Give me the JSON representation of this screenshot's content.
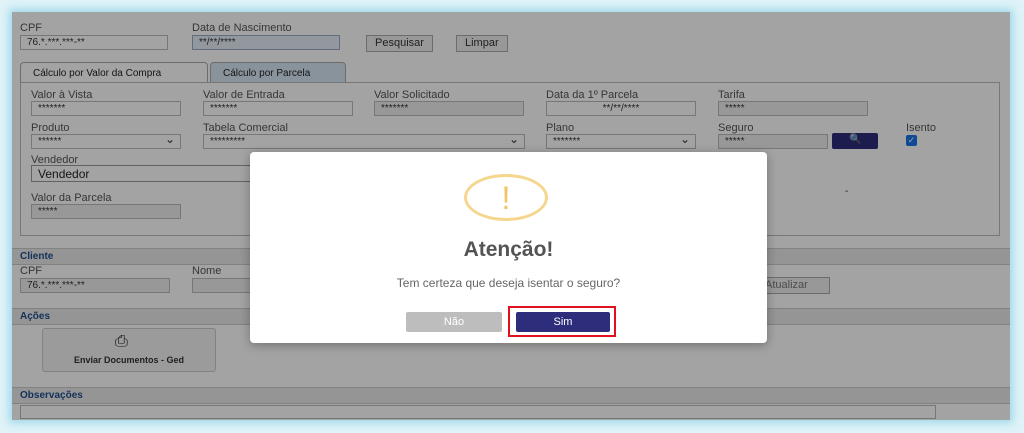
{
  "top": {
    "cpf_label": "CPF",
    "cpf_value": "76.*.***.***-**",
    "birth_label": "Data de Nascimento",
    "birth_value": "**/**/****",
    "search_button": "Pesquisar",
    "clear_button": "Limpar"
  },
  "tabs": [
    {
      "label": "Cálculo por Valor da Compra"
    },
    {
      "label": "Cálculo por Parcela"
    }
  ],
  "form": {
    "valor_vista": {
      "label": "Valor à Vista",
      "value": "*******"
    },
    "valor_entrada": {
      "label": "Valor de Entrada",
      "value": "*******"
    },
    "valor_solicitado": {
      "label": "Valor Solicitado",
      "value": "*******"
    },
    "data_parcela": {
      "label": "Data da 1º Parcela",
      "value": "**/**/****"
    },
    "tarifa": {
      "label": "Tarifa",
      "value": "*****"
    },
    "produto": {
      "label": "Produto",
      "value": "******"
    },
    "tabela": {
      "label": "Tabela Comercial",
      "value": "*********"
    },
    "plano": {
      "label": "Plano",
      "value": "*******"
    },
    "seguro": {
      "label": "Seguro",
      "value": "*****"
    },
    "isento": {
      "label": "Isento",
      "checked": true
    },
    "vendedor": {
      "label": "Vendedor",
      "value": "Vendedor"
    },
    "valor_parcela": {
      "label": "Valor da Parcela",
      "value": "*****"
    }
  },
  "cliente": {
    "section_title": "Cliente",
    "cpf_label": "CPF",
    "cpf_value": "76.*.***.***-**",
    "nome_label": "Nome",
    "update_button": "Atualizar"
  },
  "acoes": {
    "section_title": "Ações",
    "send_docs_label": "Enviar Documentos - Ged"
  },
  "observacoes": {
    "section_title": "Observações"
  },
  "modal": {
    "title": "Atenção!",
    "message": "Tem certeza que deseja isentar o seguro?",
    "no_button": "Não",
    "yes_button": "Sim",
    "icon": "exclamation-warning-icon"
  },
  "colors": {
    "accent_dark_blue": "#2d2d7c",
    "warning_yellow": "#f5d68d",
    "highlight_red": "#e0101e"
  }
}
